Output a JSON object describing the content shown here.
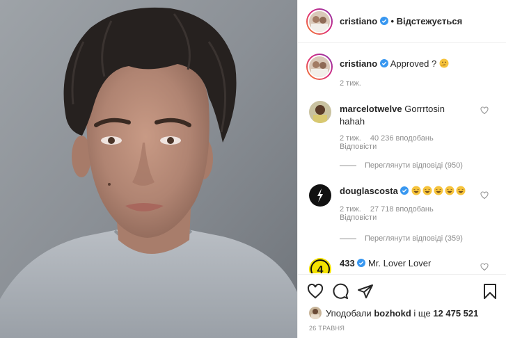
{
  "header": {
    "username": "cristiano",
    "separator": "•",
    "follow_label": "Відстежується"
  },
  "caption": {
    "username": "cristiano",
    "text": "Approved ?",
    "time": "2 тиж."
  },
  "comments": [
    {
      "username": "marcelotwelve",
      "text_line1": "Gorrrtosin",
      "text_line2": "hahah",
      "time": "2 тиж.",
      "likes": "40 236 вподобань",
      "reply_label": "Відповісти",
      "view_replies": "Переглянути відповіді (950)"
    },
    {
      "username": "douglascosta",
      "time": "2 тиж.",
      "likes": "27 718 вподобань",
      "reply_label": "Відповісти",
      "view_replies": "Переглянути відповіді (359)"
    },
    {
      "username": "433",
      "text": "Mr. Lover Lover"
    }
  ],
  "footer": {
    "liked_prefix": "Уподобали",
    "liked_user": "bozhokd",
    "liked_middle": "і ще",
    "liked_count": "12 475 521",
    "date": "26 травня"
  },
  "icons": {
    "verified": "verified-badge-icon",
    "like": "heart-icon",
    "comment": "comment-icon",
    "share": "paper-plane-icon",
    "save": "bookmark-icon"
  },
  "colors": {
    "verified_blue": "#3897f0",
    "text": "#262626",
    "muted": "#8e8e8e"
  }
}
